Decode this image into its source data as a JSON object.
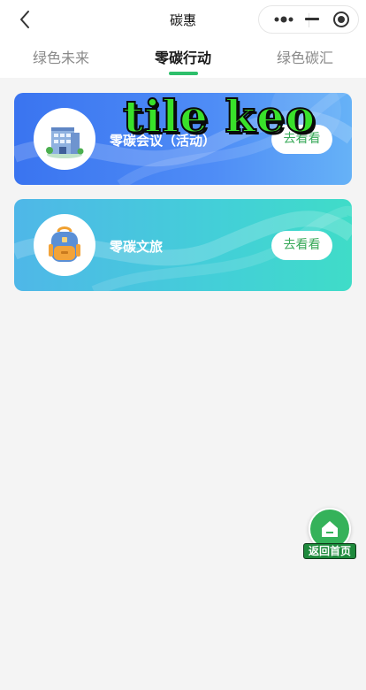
{
  "nav": {
    "title": "碳惠",
    "back_icon": "chevron-left-icon",
    "capsule": {
      "more_icon": "more-dots-icon",
      "minimize_icon": "minimize-icon",
      "close_icon": "target-close-icon"
    }
  },
  "tabs": [
    {
      "label": "绿色未来",
      "active": false
    },
    {
      "label": "零碳行动",
      "active": true
    },
    {
      "label": "绿色碳汇",
      "active": false
    }
  ],
  "cards": [
    {
      "title": "零碳会议（活动）",
      "button_label": "去看看",
      "icon": "building-icon"
    },
    {
      "title": "零碳文旅",
      "button_label": "去看看",
      "icon": "backpack-icon"
    }
  ],
  "overlay": {
    "text": "tile keo"
  },
  "home_button": {
    "label": "返回首页",
    "icon": "home-icon"
  },
  "colors": {
    "accent_green": "#2dbf6b",
    "card1_gradient": [
      "#3a74f0",
      "#66b2f7"
    ],
    "card2_gradient": [
      "#4fb7e8",
      "#3fdcc8"
    ],
    "button_text": "#3aaa5a"
  }
}
